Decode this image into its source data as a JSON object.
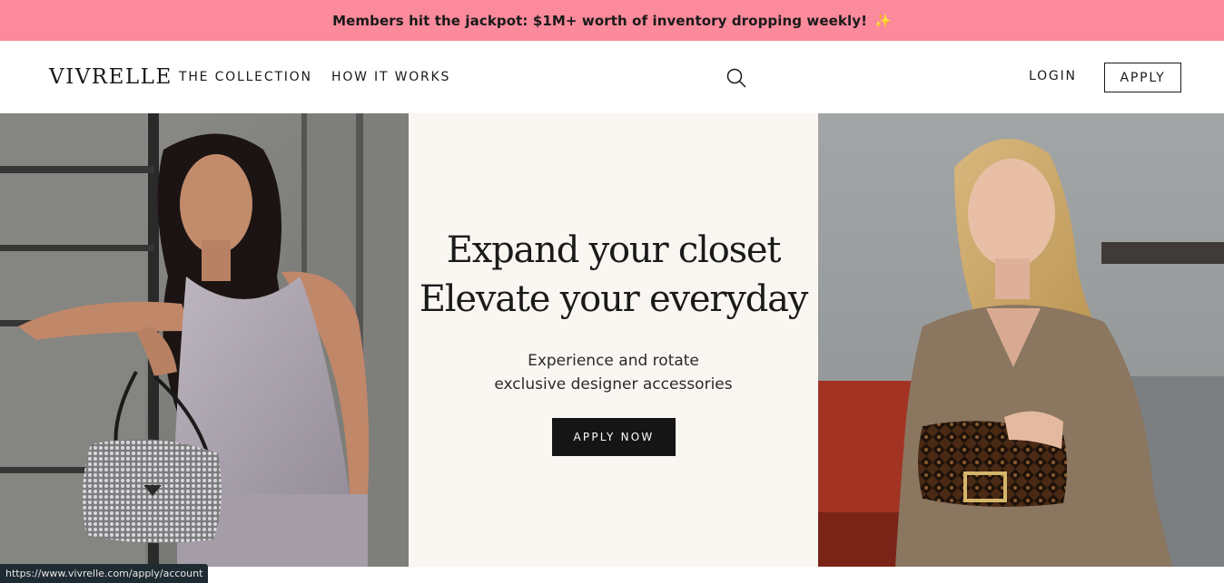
{
  "promo": {
    "text": "Members hit the jackpot: $1M+ worth of inventory dropping weekly!",
    "icon": "sparkle-icon",
    "background": "#fb8a9c"
  },
  "header": {
    "logo": "VIVRELLE",
    "nav": {
      "collection": "THE COLLECTION",
      "how_it_works": "HOW IT WORKS"
    },
    "search_icon": "search-icon",
    "login": "LOGIN",
    "apply": "APPLY"
  },
  "hero": {
    "headline_line1": "Expand your closet",
    "headline_line2": "Elevate your everyday",
    "subtext_line1": "Experience and rotate",
    "subtext_line2": "exclusive designer accessories",
    "cta": "APPLY NOW",
    "center_background": "#faf7f3"
  },
  "status_bar": {
    "url": "https://www.vivrelle.com/apply/account"
  }
}
